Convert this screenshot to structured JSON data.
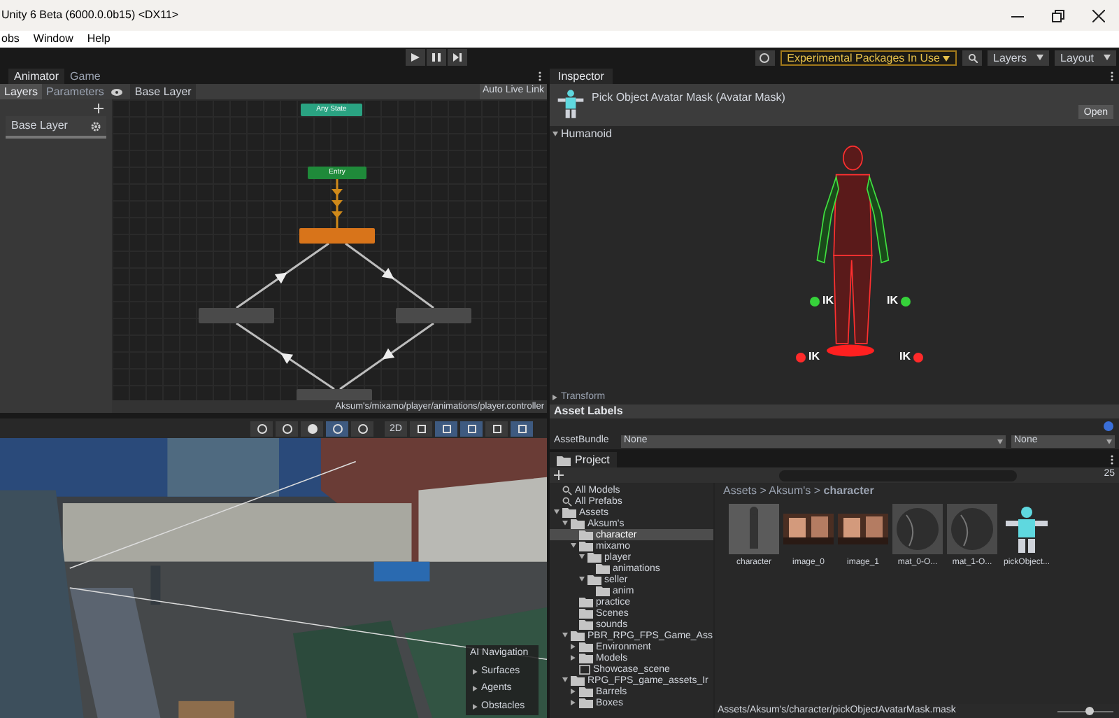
{
  "window": {
    "title": "Unity 6 Beta (6000.0.0b15) <DX11>"
  },
  "menu": [
    "obs",
    "Window",
    "Help"
  ],
  "toolbar": {
    "experimental": "Experimental Packages In Use",
    "layers": "Layers",
    "layout": "Layout"
  },
  "animator": {
    "tabs": [
      {
        "label": "Animator",
        "selected": true
      },
      {
        "label": "Game",
        "selected": false
      }
    ],
    "subtabs": [
      {
        "label": "Layers",
        "selected": true
      },
      {
        "label": "Parameters",
        "selected": false
      }
    ],
    "breadcrumb": "Base Layer",
    "live_link": "Auto Live Link",
    "layers": [
      {
        "name": "Base Layer"
      }
    ],
    "nodes": [
      {
        "kind": "any",
        "label": "Any State"
      },
      {
        "kind": "entry",
        "label": "Entry"
      },
      {
        "kind": "default"
      },
      {
        "kind": "state"
      },
      {
        "kind": "state"
      },
      {
        "kind": "state"
      }
    ],
    "path": "Aksum's/mixamo/player/animations/player.controller"
  },
  "scene": {
    "mode": "2D",
    "overlay": {
      "title": "AI Navigation",
      "items": [
        "Surfaces",
        "Agents",
        "Obstacles"
      ]
    }
  },
  "inspector": {
    "tab": "Inspector",
    "title": "Pick Object Avatar Mask (Avatar Mask)",
    "open": "Open",
    "humanoid": {
      "label": "Humanoid",
      "expanded": true
    },
    "ik": [
      "IK",
      "IK",
      "IK",
      "IK"
    ],
    "transform": {
      "label": "Transform",
      "expanded": false
    },
    "asset_labels": "Asset Labels",
    "asset_bundle": {
      "label": "AssetBundle",
      "value": "None",
      "variant": "None"
    }
  },
  "project": {
    "tab": "Project",
    "count": "25",
    "tree": [
      {
        "kind": "search",
        "label": "All Models",
        "selected": false
      },
      {
        "kind": "search",
        "label": "All Prefabs",
        "selected": false
      },
      {
        "kind": "folder",
        "label": "Assets",
        "selected": false,
        "expanded": true,
        "children": [
          {
            "kind": "folder",
            "label": "Aksum's",
            "selected": false,
            "expanded": true,
            "children": [
              {
                "kind": "folder",
                "label": "character",
                "selected": true
              },
              {
                "kind": "folder",
                "label": "mixamo",
                "selected": false,
                "expanded": true,
                "children": [
                  {
                    "kind": "folder",
                    "label": "player",
                    "selected": false,
                    "expanded": true,
                    "children": [
                      {
                        "kind": "folder",
                        "label": "animations",
                        "selected": false
                      }
                    ]
                  },
                  {
                    "kind": "folder",
                    "label": "seller",
                    "selected": false,
                    "expanded": true,
                    "children": [
                      {
                        "kind": "folder",
                        "label": "anim",
                        "selected": false
                      }
                    ]
                  }
                ]
              },
              {
                "kind": "folder",
                "label": "practice",
                "selected": false
              },
              {
                "kind": "folder",
                "label": "Scenes",
                "selected": false
              },
              {
                "kind": "folder",
                "label": "sounds",
                "selected": false
              }
            ]
          },
          {
            "kind": "folder",
            "label": "PBR_RPG_FPS_Game_Ass",
            "selected": false,
            "expanded": true,
            "children": [
              {
                "kind": "folder",
                "label": "Environment",
                "selected": false,
                "expanded": false
              },
              {
                "kind": "folder",
                "label": "Models",
                "selected": false,
                "expanded": false
              },
              {
                "kind": "scene",
                "label": "Showcase_scene",
                "selected": false
              }
            ]
          },
          {
            "kind": "folder",
            "label": "RPG_FPS_game_assets_Ir",
            "selected": false,
            "expanded": true,
            "children": [
              {
                "kind": "folder",
                "label": "Barrels",
                "selected": false,
                "expanded": false
              },
              {
                "kind": "folder",
                "label": "Boxes",
                "selected": false,
                "expanded": false
              }
            ]
          }
        ]
      }
    ],
    "breadcrumb": "Assets > Aksum's > **character**",
    "assets": [
      {
        "kind": "model",
        "label": "character"
      },
      {
        "label": "image_0"
      },
      {
        "label": "image_1"
      },
      {
        "kind": "material",
        "label": "mat_0-O..."
      },
      {
        "kind": "material",
        "label": "mat_1-O..."
      },
      {
        "kind": "mask",
        "label": "pickObject..."
      }
    ],
    "status_path": "Assets/Aksum's/character/pickObjectAvatarMask.mask",
    "zoom": {
      "level": 0.6
    }
  }
}
